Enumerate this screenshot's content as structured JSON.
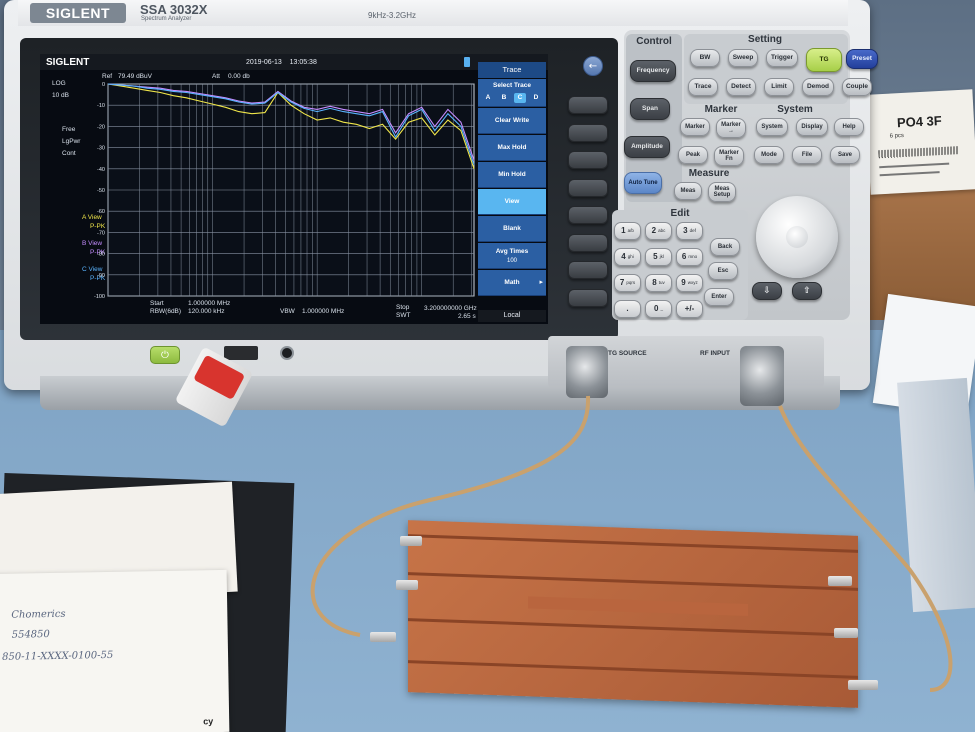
{
  "instrument": {
    "brand": "SIGLENT",
    "model": "SSA 3032X",
    "model_sub": "Spectrum Analyzer",
    "freq_range": "9kHz-3.2GHz"
  },
  "screen": {
    "brand": "SIGLENT",
    "datetime": "2019-06-13    13:05:38",
    "ref_label": "Ref",
    "ref_value": "79.49 dBuV",
    "att_label": "Att",
    "att_value": "0.00 db",
    "scale_mode": "LOG",
    "scale_div": "10 dB",
    "free_label": "Free",
    "lgpwr_label": "LgPwr",
    "cont_label": "Cont",
    "views": [
      {
        "name": "A View",
        "mode": "P-PK",
        "color": "#f0e64a"
      },
      {
        "name": "B View",
        "mode": "P-PK",
        "color": "#c48cff"
      },
      {
        "name": "C View",
        "mode": "P-PK",
        "color": "#5ab4ff"
      }
    ],
    "start_label": "Start",
    "start_value": "1.000000 MHz",
    "rbw_label": "RBW(6dB)",
    "rbw_value": "120.000 kHz",
    "vbw_label": "VBW",
    "vbw_value": "1.000000 MHz",
    "stop_label": "Stop",
    "stop_value": "3.200000000 GHz",
    "swt_label": "SWT",
    "swt_value": "2.65 s",
    "local_label": "Local"
  },
  "softmenu": {
    "title": "Trace",
    "select_label": "Select Trace",
    "traces": [
      "A",
      "B",
      "C",
      "D"
    ],
    "selected_trace": "C",
    "items": [
      {
        "label": "Clear Write",
        "sub": ""
      },
      {
        "label": "Max Hold",
        "sub": ""
      },
      {
        "label": "Min Hold",
        "sub": ""
      },
      {
        "label": "View",
        "sub": "",
        "active": true
      },
      {
        "label": "Blank",
        "sub": ""
      },
      {
        "label": "Avg Times",
        "sub": "100"
      },
      {
        "label": "Math",
        "sub": ""
      }
    ]
  },
  "chart_data": {
    "type": "line",
    "ylim": [
      -100,
      0
    ],
    "ytick_labels": [
      "0",
      "-10",
      "-20",
      "-30",
      "-40",
      "-50",
      "-60",
      "-70",
      "-80",
      "-90",
      "-100"
    ],
    "series": [
      {
        "color": "#f0e64a",
        "values": [
          0,
          -1,
          -2,
          -3,
          -4,
          -5.5,
          -6.5,
          -8,
          -9.5,
          -11,
          -13,
          -14,
          -13.5,
          -4,
          -10,
          -14,
          -17,
          -16,
          -18,
          -19,
          -21,
          -19,
          -26,
          -18,
          -16,
          -24,
          -17,
          -22,
          -40
        ]
      },
      {
        "color": "#c48cff",
        "values": [
          0,
          -0.5,
          -1,
          -1.5,
          -2,
          -3,
          -3.5,
          -4.5,
          -5.5,
          -6.5,
          -8,
          -9,
          -8.5,
          -3.5,
          -8,
          -11,
          -12,
          -10.5,
          -12,
          -13,
          -14,
          -12,
          -23,
          -14,
          -11,
          -20,
          -12,
          -18,
          -36
        ]
      },
      {
        "color": "#5ab4ff",
        "values": [
          0,
          -0.5,
          -1,
          -2,
          -2.5,
          -3.5,
          -4,
          -5,
          -6,
          -7,
          -8.5,
          -9.5,
          -9,
          -4,
          -8.5,
          -11.5,
          -13,
          -11.5,
          -13,
          -14,
          -15,
          -13,
          -25,
          -15,
          -12,
          -22,
          -14,
          -20,
          -38
        ]
      }
    ]
  },
  "panel": {
    "control_title": "Control",
    "setting_title": "Setting",
    "marker_title": "Marker",
    "system_title": "System",
    "measure_title": "Measure",
    "edit_title": "Edit",
    "frequency": "Frequency",
    "span": "Span",
    "amplitude": "Amplitude",
    "auto_tune": "Auto Tune",
    "bw": "BW",
    "sweep": "Sweep",
    "trigger": "Trigger",
    "tg": "TG",
    "preset": "Preset",
    "trace": "Trace",
    "detect": "Detect",
    "limit": "Limit",
    "demod": "Demod",
    "couple": "Couple",
    "marker": "Marker",
    "marker_arrow": "Marker\n→",
    "system": "System",
    "display": "Display",
    "help": "Help",
    "peak": "Peak",
    "marker_fn": "Marker\nFn",
    "mode": "Mode",
    "file": "File",
    "save": "Save",
    "meas": "Meas",
    "meas_setup": "Meas\nSetup",
    "keys": [
      {
        "d": "1",
        "s": "a/b"
      },
      {
        "d": "2",
        "s": "abc"
      },
      {
        "d": "3",
        "s": "def"
      },
      {
        "d": "4",
        "s": "ghi"
      },
      {
        "d": "5",
        "s": "jkl"
      },
      {
        "d": "6",
        "s": "mno"
      },
      {
        "d": "7",
        "s": "pqrs"
      },
      {
        "d": "8",
        "s": "tuv"
      },
      {
        "d": "9",
        "s": "wxyz"
      },
      {
        "d": ".",
        "s": ""
      },
      {
        "d": "0",
        "s": "_"
      },
      {
        "d": "+/-",
        "s": ""
      }
    ],
    "back": "Back",
    "esc": "Esc",
    "enter": "Enter",
    "tg_source": "TG SOURCE",
    "rf_input": "RF INPUT"
  },
  "notes": {
    "line1": "Chomerics",
    "line2": "554850",
    "line3": "850-11-XXXX-0100-55",
    "corner": "cy"
  },
  "box_label": {
    "code": "PO4 3F",
    "small": "6 pcs"
  }
}
